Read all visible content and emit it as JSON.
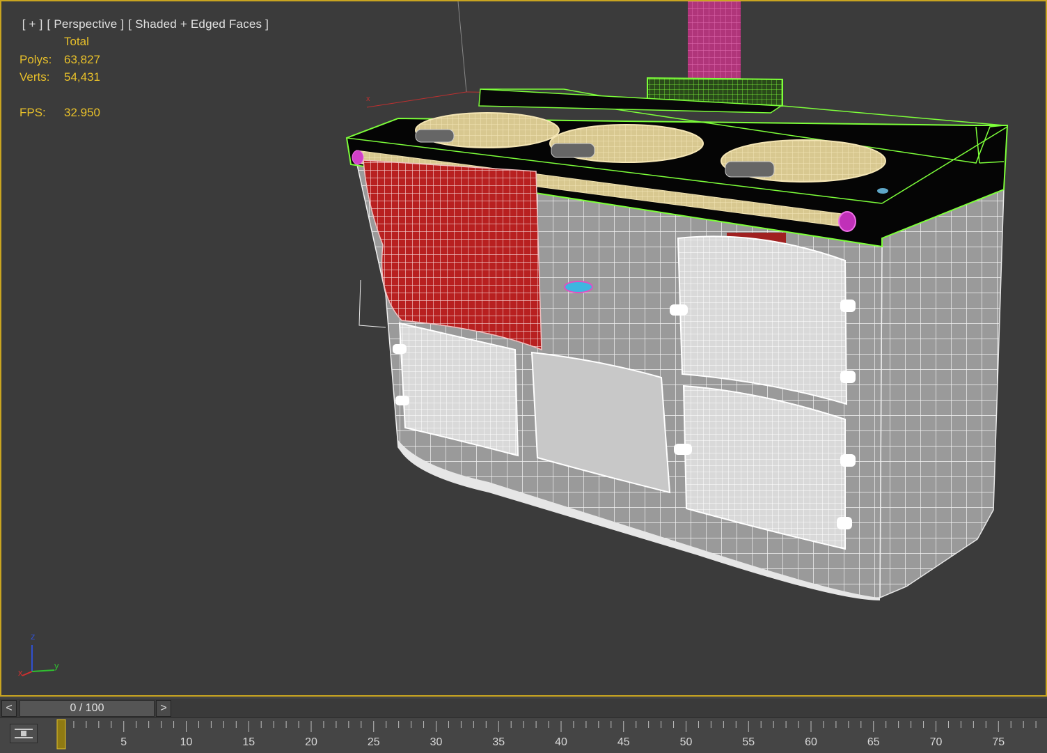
{
  "viewport": {
    "label_parts": [
      "[ + ]",
      "[ Perspective ]",
      "[ Shaded + Edged Faces ]"
    ],
    "border_color": "#c9a520"
  },
  "stats": {
    "header": "Total",
    "polys_label": "Polys:",
    "polys_value": "63,827",
    "verts_label": "Verts:",
    "verts_value": "54,431",
    "fps_label": "FPS:",
    "fps_value": "32.950"
  },
  "gizmo": {
    "x_label": "x",
    "y_label": "y",
    "z_label": "z",
    "colors": {
      "x": "#d03030",
      "y": "#30c030",
      "z": "#3050d0"
    }
  },
  "timeline": {
    "prev_label": "<",
    "next_label": ">",
    "frame_display": "0 / 100",
    "ticks": [
      "5",
      "10",
      "15",
      "20",
      "25",
      "30",
      "35",
      "40",
      "45",
      "50",
      "55",
      "60",
      "65",
      "70",
      "75"
    ],
    "current_frame": 0,
    "total_frames": 100
  },
  "icons": {
    "key_mode": "key-filter-icon",
    "prev": "chevron-left-icon",
    "next": "chevron-right-icon"
  }
}
